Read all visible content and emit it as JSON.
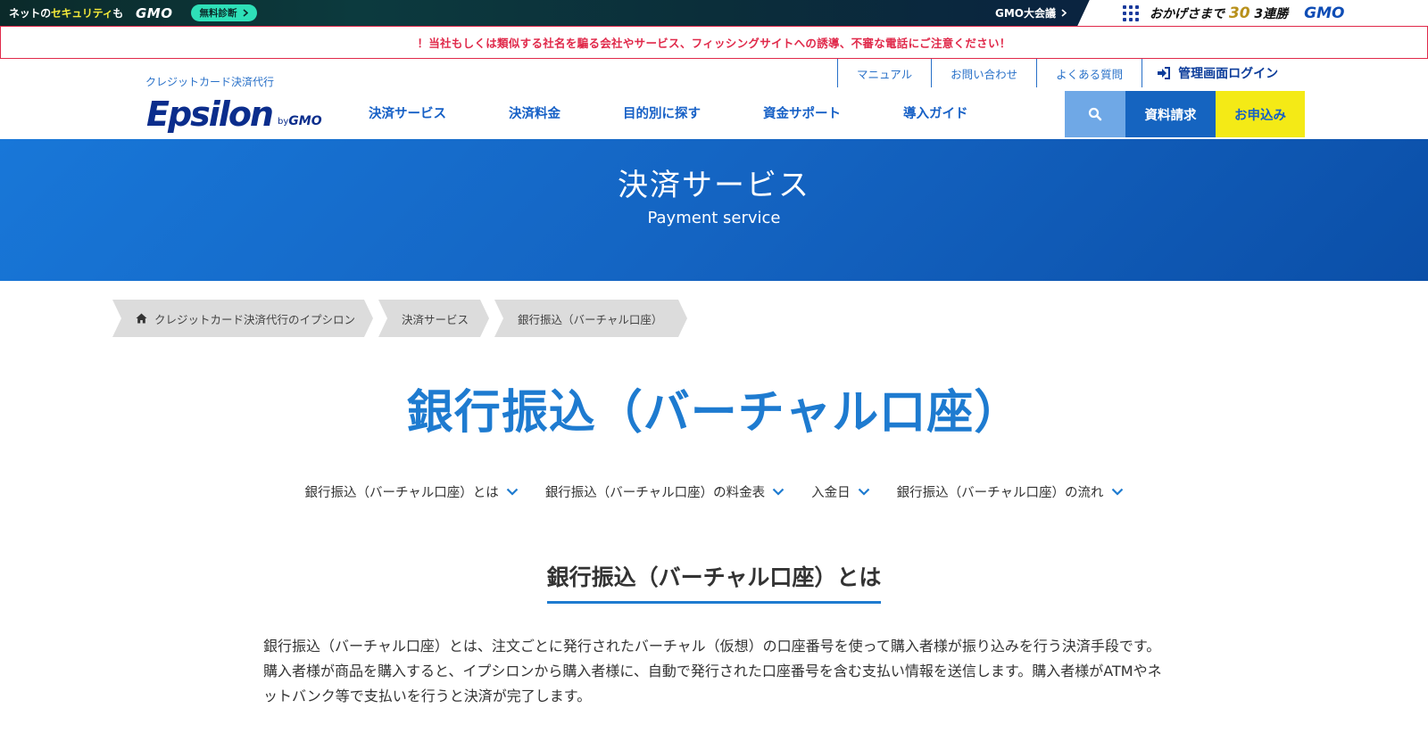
{
  "gmo_bar": {
    "tagline_pre": "ネットの",
    "tagline_highlight": "セキュリティ",
    "tagline_post": "も",
    "logo": "GMO",
    "diagnose_label": "無料診断",
    "conference_label": "GMO大会議",
    "okage_text_pre": "おかげさまで",
    "okage_thirty": "30",
    "okage_text_post": "3連勝",
    "logo_right": "GMO"
  },
  "warning": {
    "text": "！当社もしくは類似する社名を騙る会社やサービス、フィッシングサイトへの誘導、不審な電話にご注意ください！"
  },
  "header": {
    "tagline": "クレジットカード決済代行",
    "logo_main": "Epsilon",
    "logo_by": "by",
    "logo_gmo": "GMO",
    "util_nav": [
      "マニュアル",
      "お問い合わせ",
      "よくある質問"
    ],
    "login_label": "管理画面ログイン",
    "main_nav": [
      "決済サービス",
      "決済料金",
      "目的別に探す",
      "資金サポート",
      "導入ガイド"
    ],
    "request_label": "資料請求",
    "apply_label": "お申込み"
  },
  "hero": {
    "title": "決済サービス",
    "subtitle": "Payment service"
  },
  "breadcrumb": [
    "クレジットカード決済代行のイプシロン",
    "決済サービス",
    "銀行振込（バーチャル口座）"
  ],
  "page": {
    "title": "銀行振込（バーチャル口座）",
    "anchors": [
      "銀行振込（バーチャル口座）とは",
      "銀行振込（バーチャル口座）の料金表",
      "入金日",
      "銀行振込（バーチャル口座）の流れ"
    ],
    "section_title": "銀行振込（バーチャル口座）とは",
    "description": "銀行振込（バーチャル口座）とは、注文ごとに発行されたバーチャル（仮想）の口座番号を使って購入者様が振り込みを行う決済手段です。 購入者様が商品を購入すると、イプシロンから購入者様に、自動で発行された口座番号を含む支払い情報を送信します。購入者様がATMやネットバンク等で支払いを行うと決済が完了します。"
  },
  "colors": {
    "brand_blue": "#1e7bd0",
    "nav_blue": "#1660c6",
    "warning_red": "#e0294a",
    "apply_yellow": "#f4ea16"
  }
}
